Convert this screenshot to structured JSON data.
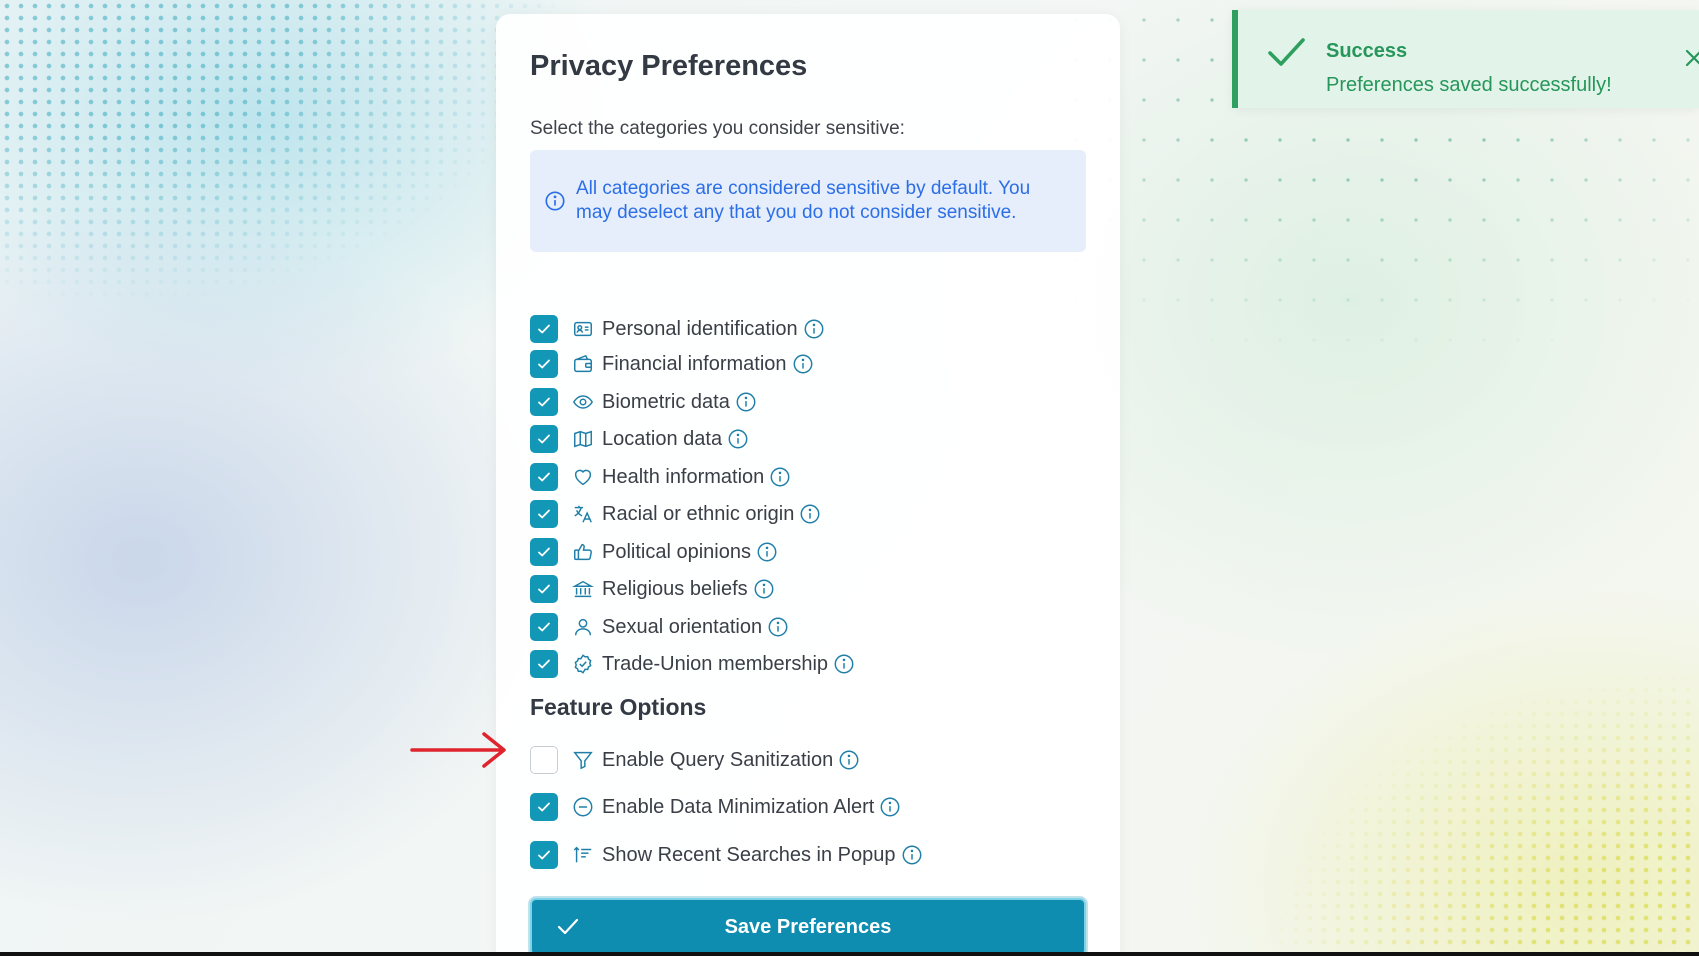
{
  "panel": {
    "title": "Privacy Preferences",
    "subtitle": "Select the categories you consider sensitive:",
    "notice": "All categories are considered sensitive by default. You may deselect any that you do not consider sensitive.",
    "accent_color": "#1297b6"
  },
  "categories": [
    {
      "label": "Personal identification",
      "icon": "id-card-icon",
      "checked": true
    },
    {
      "label": "Financial information",
      "icon": "wallet-icon",
      "checked": true
    },
    {
      "label": "Biometric data",
      "icon": "eye-icon",
      "checked": true
    },
    {
      "label": "Location data",
      "icon": "map-icon",
      "checked": true
    },
    {
      "label": "Health information",
      "icon": "heart-icon",
      "checked": true
    },
    {
      "label": "Racial or ethnic origin",
      "icon": "language-icon",
      "checked": true
    },
    {
      "label": "Political opinions",
      "icon": "thumbs-up-icon",
      "checked": true
    },
    {
      "label": "Religious beliefs",
      "icon": "building-columns-icon",
      "checked": true
    },
    {
      "label": "Sexual orientation",
      "icon": "user-icon",
      "checked": true
    },
    {
      "label": "Trade-Union membership",
      "icon": "badge-check-icon",
      "checked": true
    }
  ],
  "feature_section": {
    "title": "Feature Options",
    "options": [
      {
        "label": "Enable Query Sanitization",
        "icon": "filter-icon",
        "checked": false
      },
      {
        "label": "Enable Data Minimization Alert",
        "icon": "minus-circle-icon",
        "checked": true
      },
      {
        "label": "Show Recent Searches in Popup",
        "icon": "sort-icon",
        "checked": true
      }
    ]
  },
  "save_button": {
    "label": "Save Preferences",
    "icon": "check-icon"
  },
  "toast": {
    "title": "Success",
    "message": "Preferences saved successfully!",
    "color": "#26965a"
  }
}
